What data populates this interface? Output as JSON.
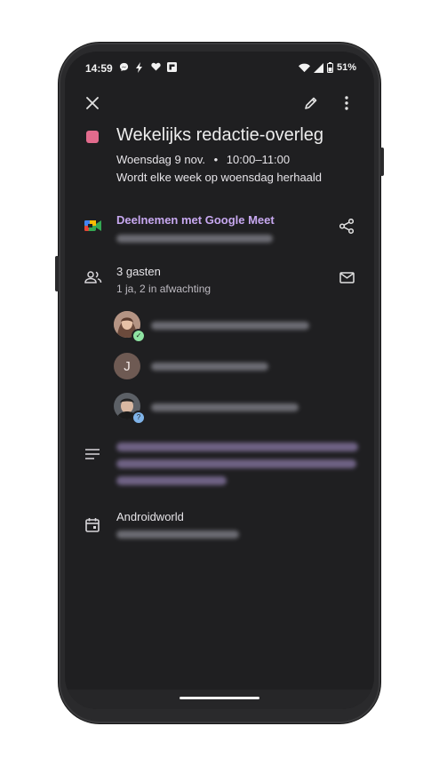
{
  "status_bar": {
    "time": "14:59",
    "battery": "51%",
    "left_icons": [
      "messenger-icon",
      "bolt-icon",
      "heart-icon",
      "flipboard-icon"
    ],
    "right_icons": [
      "wifi-icon",
      "signal-icon",
      "battery-icon"
    ]
  },
  "toolbar": {
    "close_icon": "close-icon",
    "edit_icon": "pencil-icon",
    "more_icon": "more-vert-icon"
  },
  "event": {
    "title": "Wekelijks redactie-overleg",
    "color": "#e26b8d",
    "day": "Woensdag 9 nov.",
    "separator": "•",
    "time": "10:00–11:00",
    "recurrence": "Wordt elke week op woensdag herhaald"
  },
  "meet": {
    "label": "Deelnemen met Google Meet",
    "link_color": "#c7a8f0"
  },
  "guests": {
    "title": "3 gasten",
    "subtitle": "1 ja, 2 in afwachting",
    "items": [
      {
        "avatar": "photo",
        "status": "accepted"
      },
      {
        "avatar": "letter",
        "initial": "J"
      },
      {
        "avatar": "photo",
        "status": "pending"
      }
    ]
  },
  "calendar": {
    "name": "Androidworld"
  }
}
